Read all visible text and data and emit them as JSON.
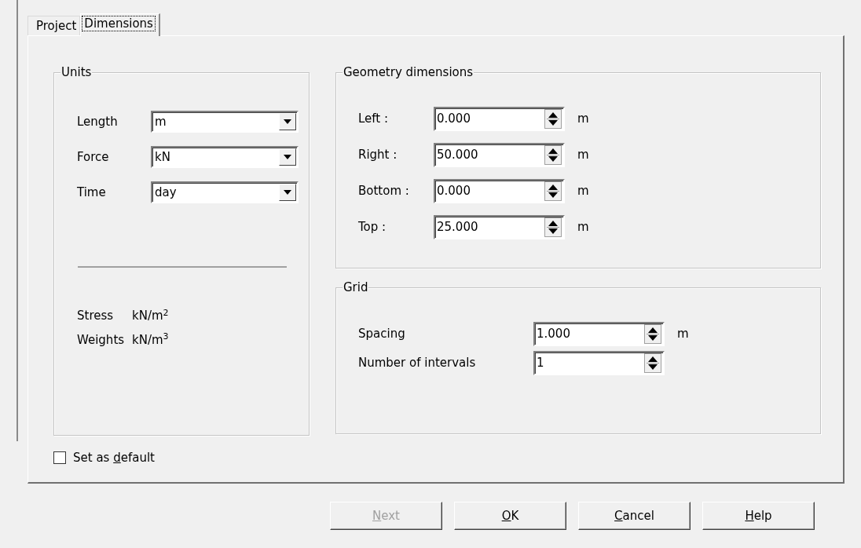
{
  "tabs": [
    {
      "label": "Project",
      "selected": false
    },
    {
      "label": "Dimensions",
      "selected": true
    }
  ],
  "units": {
    "title": "Units",
    "fields": [
      {
        "label": "Length",
        "value": "m"
      },
      {
        "label": "Force",
        "value": "kN"
      },
      {
        "label": "Time",
        "value": "day"
      }
    ],
    "derived": [
      {
        "label": "Stress",
        "value": "kN/m$^{2}$"
      },
      {
        "label": "Weights",
        "value": "kN/m$^{3}$"
      }
    ]
  },
  "geometry": {
    "title": "Geometry dimensions",
    "fields": [
      {
        "label": "Left :",
        "value": "0.000",
        "unit": "m"
      },
      {
        "label": "Right :",
        "value": "50.000",
        "unit": "m"
      },
      {
        "label": "Bottom :",
        "value": "0.000",
        "unit": "m"
      },
      {
        "label": "Top :",
        "value": "25.000",
        "unit": "m"
      }
    ]
  },
  "grid": {
    "title": "Grid",
    "fields": [
      {
        "label": "Spacing",
        "value": "1.000",
        "unit": "m"
      },
      {
        "label": "Number of intervals",
        "value": "1"
      }
    ]
  },
  "set_default": {
    "before": "Set as ",
    "key": "d",
    "after": "efault",
    "checked": false
  },
  "buttons": [
    {
      "key": "N",
      "after": "ext",
      "disabled": true
    },
    {
      "key": "O",
      "after": "K",
      "disabled": false
    },
    {
      "key": "C",
      "after": "ancel",
      "disabled": false
    },
    {
      "key": "H",
      "after": "elp",
      "disabled": false
    }
  ]
}
